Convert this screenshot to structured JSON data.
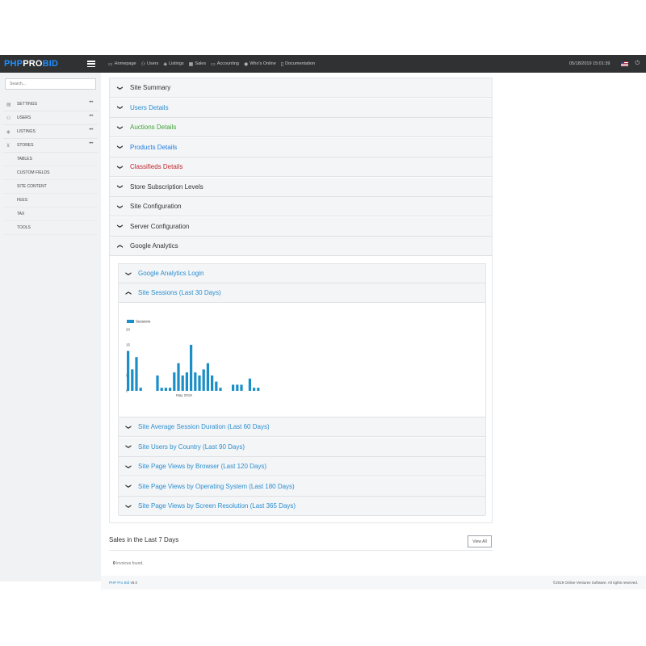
{
  "brand": {
    "part1": "PHP",
    "part2": "PRO",
    "part3": "BID"
  },
  "topnav": [
    {
      "icon": "desktop-icon",
      "label": "Homepage"
    },
    {
      "icon": "users-icon",
      "label": "Users"
    },
    {
      "icon": "listings-icon",
      "label": "Listings"
    },
    {
      "icon": "calendar-icon",
      "label": "Sales"
    },
    {
      "icon": "money-icon",
      "label": "Accounting"
    },
    {
      "icon": "signal-icon",
      "label": "Who's Online"
    },
    {
      "icon": "book-icon",
      "label": "Documentation"
    }
  ],
  "datetime": "05/18/2019 15:01:39",
  "sidebar": {
    "search_placeholder": "Search...",
    "items": [
      {
        "icon": "settings-icon",
        "label": "SETTINGS"
      },
      {
        "icon": "users-icon",
        "label": "USERS"
      },
      {
        "icon": "listings-icon",
        "label": "LISTINGS"
      },
      {
        "icon": "cart-icon",
        "label": "STORES"
      }
    ],
    "subitems": [
      "TABLES",
      "CUSTOM FIELDS",
      "SITE CONTENT",
      "FEES",
      "TAX",
      "TOOLS"
    ]
  },
  "accordion": [
    {
      "label": "Site Summary",
      "color": "#333333",
      "open": false
    },
    {
      "label": "Users Details",
      "color": "#2b8fcf",
      "open": false
    },
    {
      "label": "Auctions Details",
      "color": "#3fa535",
      "open": false
    },
    {
      "label": "Products Details",
      "color": "#1f7de0",
      "open": false
    },
    {
      "label": "Classifieds Details",
      "color": "#c0272d",
      "open": false
    },
    {
      "label": "Store Subscription Levels",
      "color": "#333333",
      "open": false
    },
    {
      "label": "Site Configuration",
      "color": "#333333",
      "open": false
    },
    {
      "label": "Server Configuration",
      "color": "#333333",
      "open": false
    },
    {
      "label": "Google Analytics",
      "color": "#333333",
      "open": true
    }
  ],
  "analytics": [
    {
      "label": "Google Analytics Login",
      "open": false
    },
    {
      "label": "Site Sessions (Last 30 Days)",
      "open": true
    },
    {
      "label": "Site Average Session Duration (Last 60 Days)",
      "open": false
    },
    {
      "label": "Site Users by Country (Last 90 Days)",
      "open": false
    },
    {
      "label": "Site Page Views by Browser (Last 120 Days)",
      "open": false
    },
    {
      "label": "Site Page Views by Operating System (Last 180 Days)",
      "open": false
    },
    {
      "label": "Site Page Views by Screen Resolution (Last 365 Days)",
      "open": false
    }
  ],
  "chart_data": {
    "type": "bar",
    "series": [
      {
        "name": "Sessions",
        "color": "#1a8fc7",
        "values": [
          13,
          7,
          11,
          1,
          0,
          0,
          0,
          5,
          1,
          1,
          1,
          6,
          9,
          5,
          6,
          15,
          6,
          5,
          7,
          9,
          5,
          3,
          1,
          0,
          0,
          2,
          2,
          2,
          0,
          4,
          1,
          1
        ]
      }
    ],
    "yticks": [
      0,
      5,
      15,
      20
    ],
    "ylim": [
      0,
      20
    ],
    "xlabel": "May 2019",
    "grid": false,
    "legend": "top-left"
  },
  "sales": {
    "title": "Sales in the Last 7 Days",
    "view_all": "View All",
    "count": "0",
    "empty_text": "invoices found."
  },
  "footer": {
    "product": "PHP Pro Bid",
    "version": "v8.0",
    "copyright": "©2019 Online Ventures Software. All rights reserved."
  }
}
